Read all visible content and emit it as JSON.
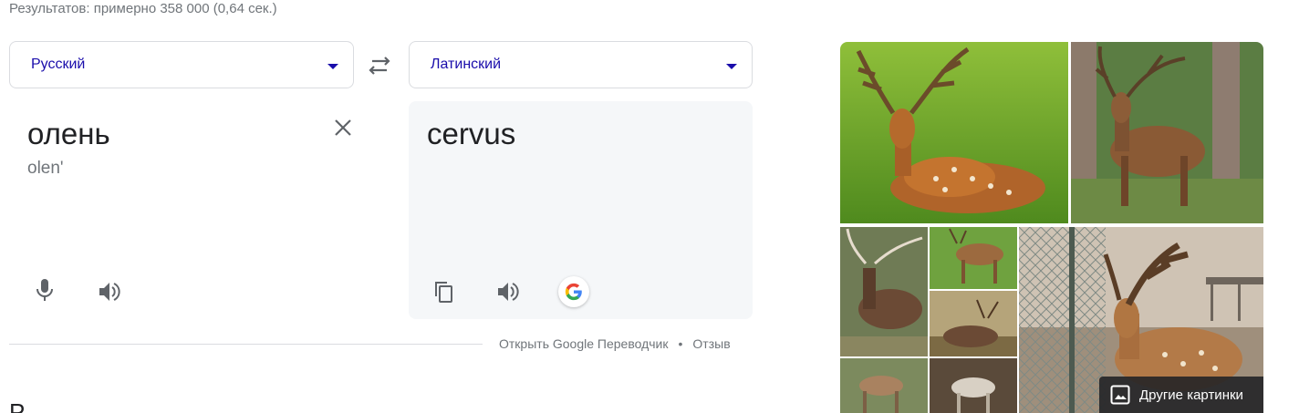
{
  "search": {
    "result_stats": "Результатов: примерно 358 000 (0,64 сек.)"
  },
  "translator": {
    "source_language": "Русский",
    "target_language": "Латинский",
    "source_text": "олень",
    "transliteration": "olen'",
    "translated_text": "cervus",
    "footer": {
      "open_translator": "Открыть Google Переводчик",
      "separator": "•",
      "feedback": "Отзыв"
    }
  },
  "images": {
    "more_label": "Другие картинки"
  },
  "next_section": {
    "heading": "Р"
  },
  "colors": {
    "link": "#1a0dab",
    "secondary_text": "#70757a",
    "icon": "#5f6368",
    "panel_bg": "#f5f7f9",
    "border": "#dadce0"
  }
}
